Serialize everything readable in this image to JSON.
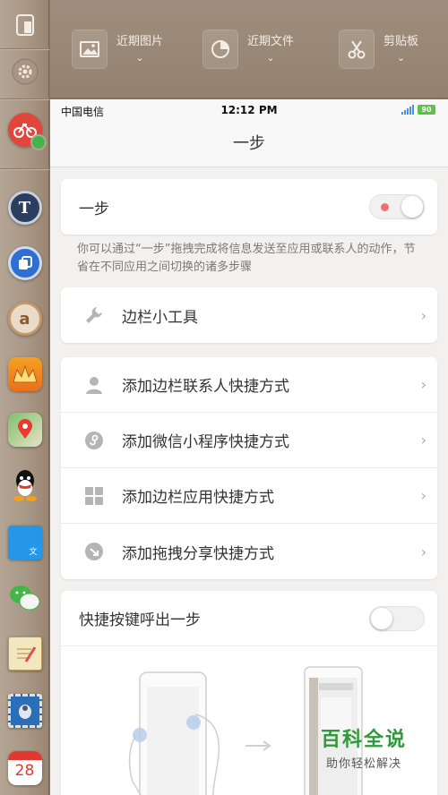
{
  "sidebar": {
    "top_icon": "window-icon",
    "settings_icon": "gear-icon",
    "apps": [
      {
        "name": "mobike-app",
        "color": "#e2453c"
      },
      {
        "name": "typeeto-app",
        "color": "#2c3e5e"
      },
      {
        "name": "copy-app",
        "color": "#2f6fd3"
      },
      {
        "name": "amazon-app",
        "color": "#c3996b"
      },
      {
        "name": "crown-app",
        "color": "#f5a123"
      },
      {
        "name": "baidu-map-app",
        "color": "#7cc06a"
      },
      {
        "name": "qq-app",
        "color": "#111111"
      },
      {
        "name": "blue-book-app",
        "color": "#2596e8"
      },
      {
        "name": "wechat-app",
        "color": "#44b649"
      },
      {
        "name": "notepad-app",
        "color": "#e9d9a8"
      },
      {
        "name": "mail-app",
        "color": "#2b6fb8"
      },
      {
        "name": "calendar-app",
        "color": "#ffffff"
      }
    ],
    "calendar_day": "28"
  },
  "toolbar": {
    "items": [
      {
        "label": "近期图片",
        "icon": "image-icon"
      },
      {
        "label": "近期文件",
        "icon": "pie-chart-icon"
      },
      {
        "label": "剪贴板",
        "icon": "scissors-icon"
      }
    ],
    "chevron": "⌄"
  },
  "statusbar": {
    "carrier": "中国电信",
    "time": "12:12 PM",
    "battery": "90"
  },
  "navbar": {
    "title": "一步"
  },
  "main_toggle": {
    "label": "一步",
    "state": "on"
  },
  "description": "你可以通过“一步”拖拽完成将信息发送至应用或联系人的动作，节省在不同应用之间切换的诸多步骤",
  "tools_row": {
    "label": "边栏小工具",
    "icon": "wrench-icon"
  },
  "shortcut_rows": [
    {
      "label": "添加边栏联系人快捷方式",
      "icon": "person-icon"
    },
    {
      "label": "添加微信小程序快捷方式",
      "icon": "mini-program-icon"
    },
    {
      "label": "添加边栏应用快捷方式",
      "icon": "grid-icon"
    },
    {
      "label": "添加拖拽分享快捷方式",
      "icon": "share-arrow-icon"
    }
  ],
  "hotkey_toggle": {
    "label": "快捷按键呼出一步",
    "state": "off"
  },
  "row_chevron": "›",
  "watermark": {
    "title": "百科全说",
    "subtitle": "助你轻松解决"
  }
}
